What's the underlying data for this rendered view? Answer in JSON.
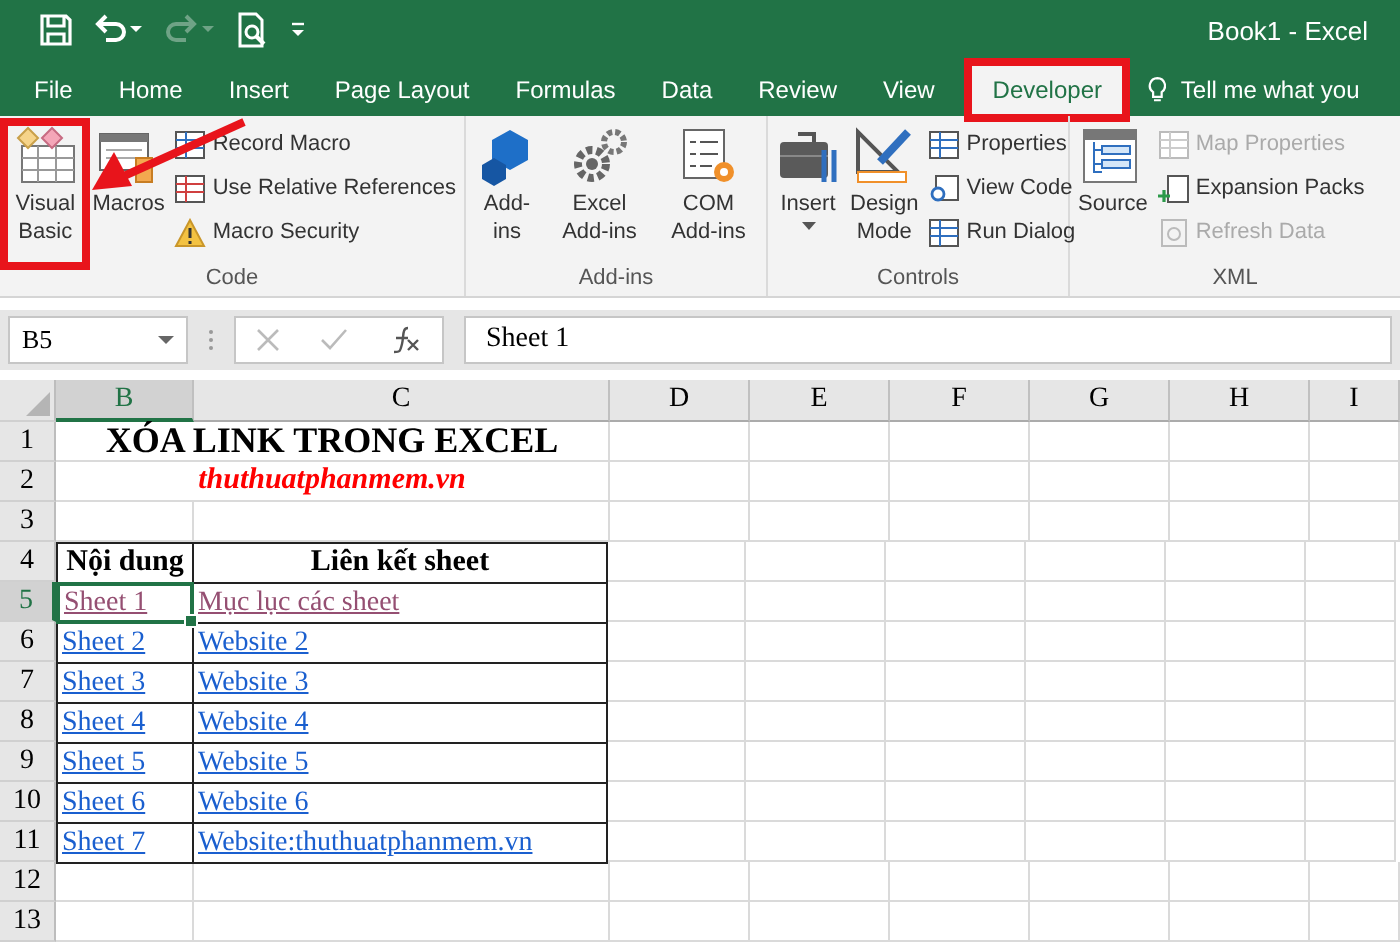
{
  "window": {
    "title": "Book1 - Excel"
  },
  "tabs": [
    {
      "label": "File",
      "selected": false,
      "highlighted": false
    },
    {
      "label": "Home",
      "selected": false,
      "highlighted": false
    },
    {
      "label": "Insert",
      "selected": false,
      "highlighted": false
    },
    {
      "label": "Page Layout",
      "selected": false,
      "highlighted": false
    },
    {
      "label": "Formulas",
      "selected": false,
      "highlighted": false
    },
    {
      "label": "Data",
      "selected": false,
      "highlighted": false
    },
    {
      "label": "Review",
      "selected": false,
      "highlighted": false
    },
    {
      "label": "View",
      "selected": false,
      "highlighted": false
    },
    {
      "label": "Developer",
      "selected": true,
      "highlighted": true
    }
  ],
  "tell_me": {
    "placeholder": "Tell me what you"
  },
  "ribbon": {
    "groups": [
      {
        "label": "Code",
        "large": [
          {
            "label": "Visual Basic",
            "highlighted": true
          },
          {
            "label": "Macros",
            "highlighted": false
          }
        ],
        "small": [
          {
            "label": "Record Macro",
            "disabled": false
          },
          {
            "label": "Use Relative References",
            "disabled": false
          },
          {
            "label": "Macro Security",
            "disabled": false
          }
        ]
      },
      {
        "label": "Add-ins",
        "large": [
          {
            "label": "Add-ins",
            "highlighted": false
          },
          {
            "label": "Excel Add-ins",
            "highlighted": false
          },
          {
            "label": "COM Add-ins",
            "highlighted": false
          }
        ]
      },
      {
        "label": "Controls",
        "large": [
          {
            "label": "Insert",
            "highlighted": false
          },
          {
            "label": "Design Mode",
            "highlighted": false
          }
        ],
        "small": [
          {
            "label": "Properties",
            "disabled": false
          },
          {
            "label": "View Code",
            "disabled": false
          },
          {
            "label": "Run Dialog",
            "disabled": false
          }
        ]
      },
      {
        "label": "XML",
        "large": [
          {
            "label": "Source",
            "highlighted": false
          }
        ],
        "small": [
          {
            "label": "Map Properties",
            "disabled": true
          },
          {
            "label": "Expansion Packs",
            "disabled": false
          },
          {
            "label": "Refresh Data",
            "disabled": true
          }
        ]
      }
    ]
  },
  "formula_bar": {
    "name_box": "B5",
    "formula": "Sheet 1"
  },
  "sheet": {
    "columns": [
      {
        "label": "B",
        "selected": true
      },
      {
        "label": "C",
        "selected": false
      },
      {
        "label": "D",
        "selected": false
      },
      {
        "label": "E",
        "selected": false
      },
      {
        "label": "F",
        "selected": false
      },
      {
        "label": "G",
        "selected": false
      },
      {
        "label": "H",
        "selected": false
      },
      {
        "label": "I",
        "selected": false
      }
    ],
    "rows": [
      {
        "header": "1",
        "selected": false,
        "kind": "title",
        "cells": [
          {
            "text": "XÓA LINK TRONG EXCEL"
          }
        ]
      },
      {
        "header": "2",
        "selected": false,
        "kind": "subtitle",
        "cells": [
          {
            "text": "thuthuatphanmem.vn"
          }
        ]
      },
      {
        "header": "3",
        "selected": false,
        "kind": "empty",
        "cells": []
      },
      {
        "header": "4",
        "selected": false,
        "kind": "head",
        "cells": [
          {
            "text": "Nội dung"
          },
          {
            "text": "Liên kết sheet"
          }
        ]
      },
      {
        "header": "5",
        "selected": true,
        "kind": "links",
        "cells": [
          {
            "text": "Sheet 1",
            "visited": true,
            "active": true
          },
          {
            "text": "Mục lục các sheet",
            "visited": true,
            "active": false
          }
        ]
      },
      {
        "header": "6",
        "selected": false,
        "kind": "links",
        "cells": [
          {
            "text": "Sheet 2",
            "visited": false,
            "active": false
          },
          {
            "text": "Website 2",
            "visited": false,
            "active": false
          }
        ]
      },
      {
        "header": "7",
        "selected": false,
        "kind": "links",
        "cells": [
          {
            "text": "Sheet 3",
            "visited": false,
            "active": false
          },
          {
            "text": "Website 3",
            "visited": false,
            "active": false
          }
        ]
      },
      {
        "header": "8",
        "selected": false,
        "kind": "links",
        "cells": [
          {
            "text": "Sheet 4",
            "visited": false,
            "active": false
          },
          {
            "text": "Website 4",
            "visited": false,
            "active": false
          }
        ]
      },
      {
        "header": "9",
        "selected": false,
        "kind": "links",
        "cells": [
          {
            "text": "Sheet 5",
            "visited": false,
            "active": false
          },
          {
            "text": "Website 5",
            "visited": false,
            "active": false
          }
        ]
      },
      {
        "header": "10",
        "selected": false,
        "kind": "links",
        "cells": [
          {
            "text": "Sheet 6",
            "visited": false,
            "active": false
          },
          {
            "text": "Website 6",
            "visited": false,
            "active": false
          }
        ]
      },
      {
        "header": "11",
        "selected": false,
        "kind": "links",
        "cells": [
          {
            "text": "Sheet 7",
            "visited": false,
            "active": false
          },
          {
            "text": "Website:thuthuatphanmem.vn",
            "visited": false,
            "active": false
          }
        ]
      },
      {
        "header": "12",
        "selected": false,
        "kind": "empty",
        "cells": []
      },
      {
        "header": "13",
        "selected": false,
        "kind": "empty",
        "cells": []
      }
    ]
  }
}
